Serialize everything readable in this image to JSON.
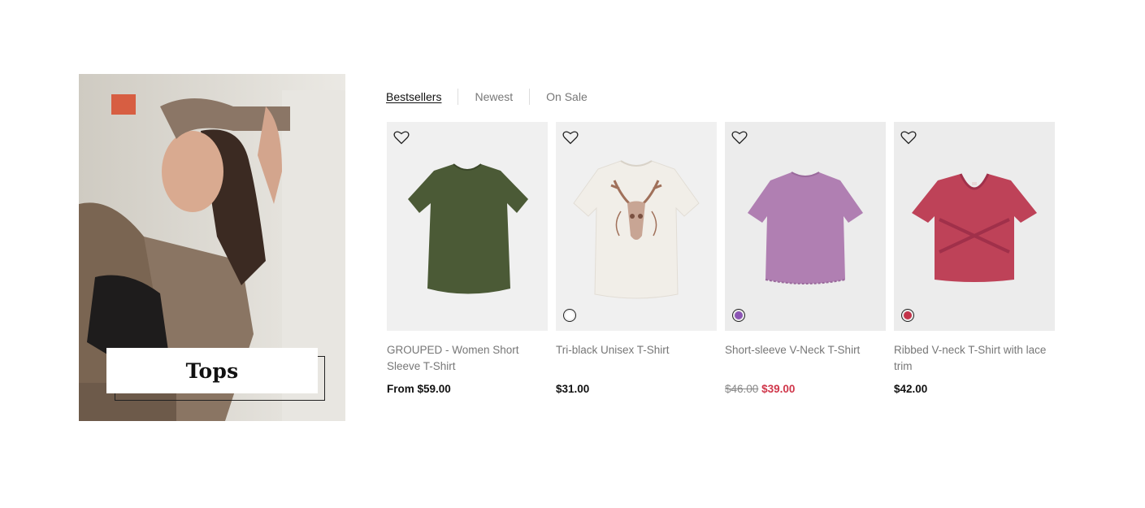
{
  "banner": {
    "label": "Tops"
  },
  "tabs": [
    {
      "label": "Bestsellers",
      "active": true
    },
    {
      "label": "Newest",
      "active": false
    },
    {
      "label": "On Sale",
      "active": false
    }
  ],
  "products": [
    {
      "name": "GROUPED - Women Short Sleeve T-Shirt",
      "price": "From $59.00",
      "swatch": null,
      "garment_color": "#4b5a36"
    },
    {
      "name": "Tri-black Unisex T-Shirt",
      "price": "$31.00",
      "swatch": "#ffffff",
      "garment_color": "#f1eee8"
    },
    {
      "name": "Short-sleeve V-Neck T-Shirt",
      "price_old": "$46.00",
      "price_sale": "$39.00",
      "swatch": "#8c55b5",
      "garment_color": "#b07fb2"
    },
    {
      "name": "Ribbed V-neck T-Shirt with lace trim",
      "price": "$42.00",
      "swatch": "#c3334a",
      "garment_color": "#be4258"
    }
  ],
  "colors": {
    "sale_price": "#d0364a",
    "image_bg": "#f0f0f0"
  },
  "icons": {
    "wishlist": "heart-outline-icon"
  }
}
